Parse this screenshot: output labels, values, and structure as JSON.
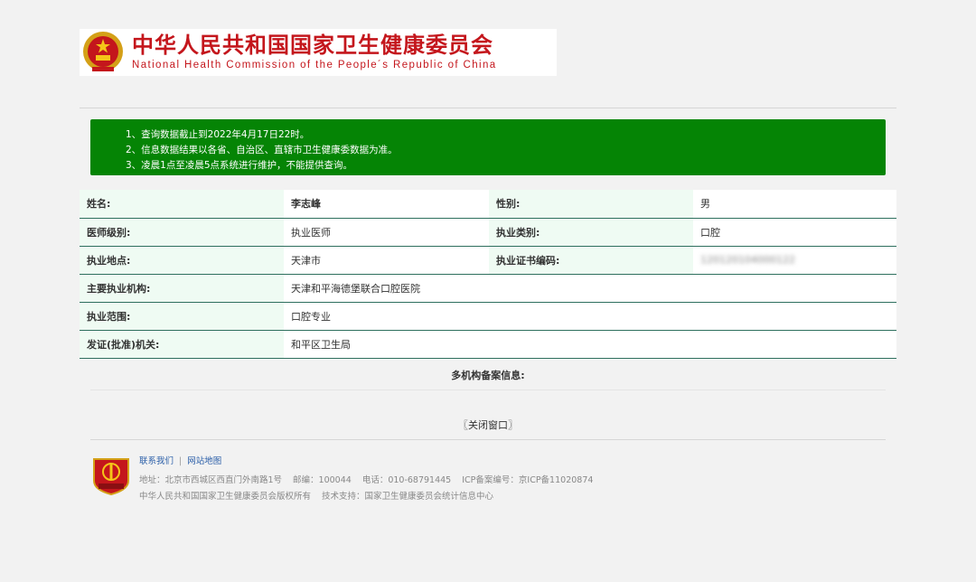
{
  "header": {
    "title_cn": "中华人民共和国国家卫生健康委员会",
    "title_en": "National Health Commission of the People´s Republic of China",
    "emblem_icon": "national-emblem-icon",
    "brand_color": "#c4161c"
  },
  "notice": {
    "bg_color": "#058405",
    "lines": [
      "1、查询数据截止到2022年4月17日22时。",
      "2、信息数据结果以各省、自治区、直辖市卫生健康委数据为准。",
      "3、凌晨1点至凌晨5点系统进行维护，不能提供查询。"
    ]
  },
  "info": {
    "name_label": "姓名:",
    "name_value": "李志峰",
    "gender_label": "性别:",
    "gender_value": "男",
    "level_label": "医师级别:",
    "level_value": "执业医师",
    "category_label": "执业类别:",
    "category_value": "口腔",
    "location_label": "执业地点:",
    "location_value": "天津市",
    "cert_label": "执业证书编码:",
    "cert_value": "120120104000122",
    "institution_label": "主要执业机构:",
    "institution_value": "天津和平海德堡联合口腔医院",
    "scope_label": "执业范围:",
    "scope_value": "口腔专业",
    "issuer_label": "发证(批准)机关:",
    "issuer_value": "和平区卫生局"
  },
  "multi_label": "多机构备案信息:",
  "close_label": "〖关闭窗口〗",
  "footer": {
    "badge_icon": "government-site-badge-icon",
    "contact_label": "联系我们",
    "sitemap_label": "网站地图",
    "separator": "|",
    "address": "地址：北京市西城区西直门外南路1号",
    "postcode": "邮编：100044",
    "phone": "电话：010-68791445",
    "icp": "ICP备案编号：京ICP备11020874",
    "copyright": "中华人民共和国国家卫生健康委员会版权所有",
    "support": "技术支持：国家卫生健康委员会统计信息中心"
  }
}
